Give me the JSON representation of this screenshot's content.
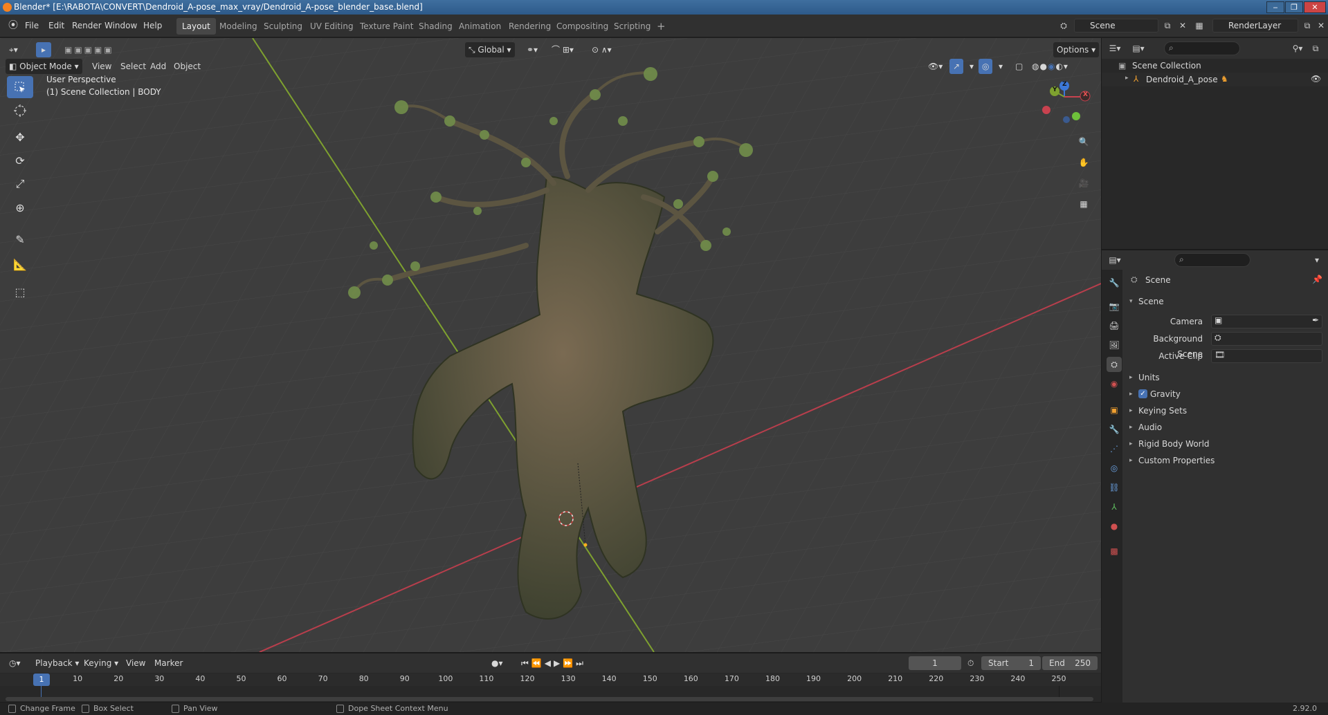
{
  "window": {
    "title": "Blender* [E:\\RABOTA\\CONVERT\\Dendroid_A-pose_max_vray/Dendroid_A-pose_blender_base.blend]"
  },
  "menu": [
    "File",
    "Edit",
    "Render",
    "Window",
    "Help"
  ],
  "workspaces": [
    {
      "label": "Layout",
      "active": true
    },
    {
      "label": "Modeling"
    },
    {
      "label": "Sculpting"
    },
    {
      "label": "UV Editing"
    },
    {
      "label": "Texture Paint"
    },
    {
      "label": "Shading"
    },
    {
      "label": "Animation"
    },
    {
      "label": "Rendering"
    },
    {
      "label": "Compositing"
    },
    {
      "label": "Scripting"
    }
  ],
  "add_workspace": "+",
  "scene_selector": {
    "value": "Scene"
  },
  "render_layer": {
    "value": "RenderLayer"
  },
  "viewport": {
    "transform_orientation": "Global",
    "options_label": "Options",
    "mode": "Object Mode",
    "header_menus": [
      "View",
      "Select",
      "Add",
      "Object"
    ],
    "overlay_title": "User Perspective",
    "overlay_subtitle": "(1) Scene Collection | BODY",
    "gizmo_axes": {
      "x": "X",
      "y": "Y",
      "z": "Z"
    }
  },
  "tools": [
    "select-box",
    "cursor",
    "move",
    "rotate",
    "scale",
    "transform",
    "annotate",
    "measure",
    "add-cube"
  ],
  "outliner": {
    "root": "Scene Collection",
    "items": [
      {
        "label": "Dendroid_A_pose"
      }
    ]
  },
  "properties": {
    "header_title": "Scene",
    "panel_title": "Scene",
    "fields": [
      {
        "label": "Camera"
      },
      {
        "label": "Background Scene"
      },
      {
        "label": "Active Clip"
      }
    ],
    "sections": [
      {
        "label": "Units"
      },
      {
        "label": "Gravity",
        "checkbox": true
      },
      {
        "label": "Keying Sets"
      },
      {
        "label": "Audio"
      },
      {
        "label": "Rigid Body World"
      },
      {
        "label": "Custom Properties"
      }
    ]
  },
  "timeline": {
    "menus": [
      "Playback",
      "Keying",
      "View",
      "Marker"
    ],
    "current_frame": "1",
    "start_label": "Start",
    "start": "1",
    "end_label": "End",
    "end": "250",
    "ticks": [
      "1",
      "10",
      "20",
      "30",
      "40",
      "50",
      "60",
      "70",
      "80",
      "90",
      "100",
      "110",
      "120",
      "130",
      "140",
      "150",
      "160",
      "170",
      "180",
      "190",
      "200",
      "210",
      "220",
      "230",
      "240",
      "250"
    ]
  },
  "statusbar": {
    "items": [
      "Change Frame",
      "Box Select",
      "Pan View",
      "Dope Sheet Context Menu"
    ],
    "version": "2.92.0"
  },
  "colors": {
    "accent": "#4772b3",
    "x_axis": "#c8424f",
    "y_axis": "#7ea12f",
    "z_axis": "#3c78d8"
  }
}
